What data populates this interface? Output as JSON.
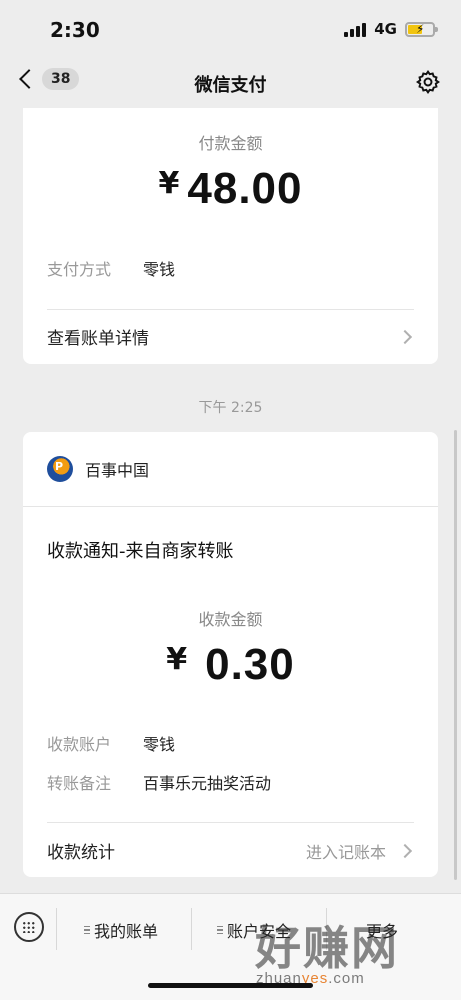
{
  "status_bar": {
    "time": "2:30",
    "network": "4G"
  },
  "nav": {
    "unread_count": "38",
    "title": "微信支付"
  },
  "payment_card": {
    "amount_label": "付款金额",
    "currency": "¥",
    "amount": "48.00",
    "method_label": "支付方式",
    "method_value": "零钱",
    "details_link": "查看账单详情"
  },
  "timestamp": "下午 2:25",
  "receipt_card": {
    "merchant_name": "百事中国",
    "notice_title": "收款通知-来自商家转账",
    "amount_label": "收款金额",
    "currency": "¥",
    "amount": "0.30",
    "account_label": "收款账户",
    "account_value": "零钱",
    "remark_label": "转账备注",
    "remark_value": "百事乐元抽奖活动",
    "stats_label": "收款统计",
    "stats_link": "进入记账本"
  },
  "bottom_menu": {
    "items": [
      "我的账单",
      "账户安全",
      "更多"
    ]
  },
  "watermark": {
    "big": "好赚网",
    "small_pre": "zhuan",
    "small_hl": "yes",
    "small_post": ".com"
  },
  "colors": {
    "background": "#ededed",
    "card": "#ffffff",
    "battery": "#f1c40f"
  }
}
